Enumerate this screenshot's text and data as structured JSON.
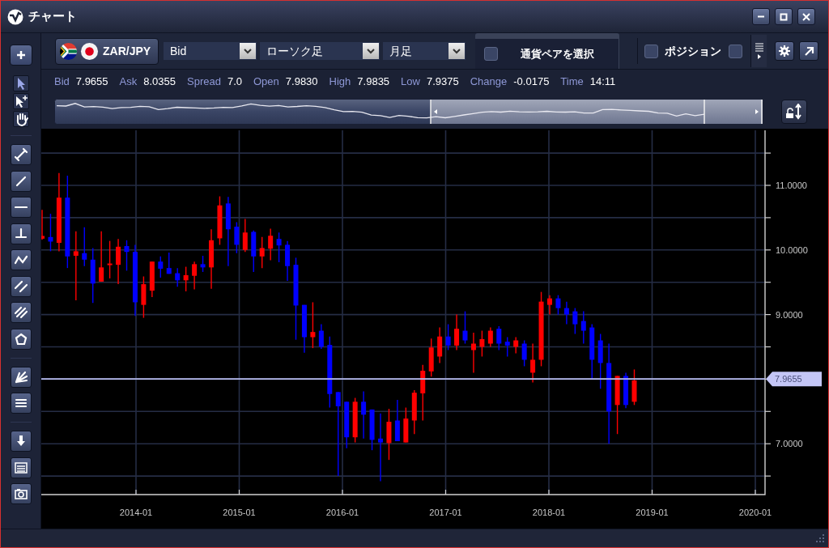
{
  "window": {
    "title": "チャート"
  },
  "toolbar": {
    "pair": "ZAR/JPY",
    "price_type": "Bid",
    "chart_type": "ローソク足",
    "period": "月足",
    "pair_select": {
      "label": "通貨ペアを選択",
      "checked": false
    },
    "checkboxes": [
      {
        "label": "ポジション",
        "checked": false
      },
      {
        "checked": false
      }
    ]
  },
  "quote": [
    {
      "label": "Bid",
      "value": "7.9655"
    },
    {
      "label": "Ask",
      "value": "8.0355"
    },
    {
      "label": "Spread",
      "value": "7.0"
    },
    {
      "label": "Open",
      "value": "7.9830"
    },
    {
      "label": "High",
      "value": "7.9835"
    },
    {
      "label": "Low",
      "value": "7.9375"
    },
    {
      "label": "Change",
      "value": "-0.0175"
    },
    {
      "label": "Time",
      "value": "14:11"
    }
  ],
  "chart": {
    "y_ticks": [
      "11.0000",
      "10.0000",
      "9.0000",
      "7.0000"
    ],
    "x_ticks": [
      "2014-01",
      "2015-01",
      "2016-01",
      "2017-01",
      "2018-01",
      "2019-01",
      "2020-01"
    ],
    "current_price": "7.9655"
  }
}
